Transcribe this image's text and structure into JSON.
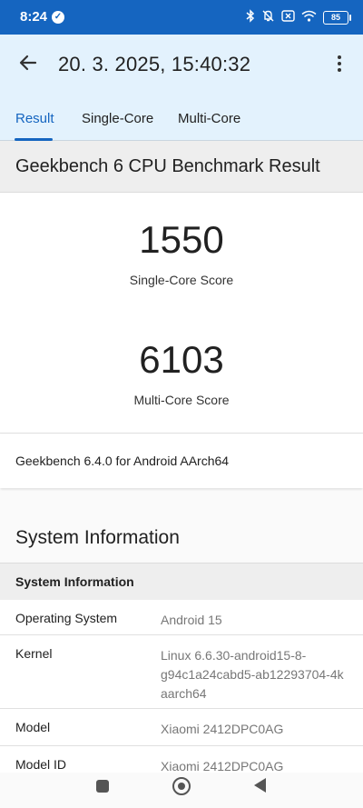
{
  "status_bar": {
    "time": "8:24",
    "battery": "85",
    "icons": [
      "check-circle-icon",
      "bluetooth-icon",
      "bell-off-icon",
      "sim-icon",
      "wifi-icon",
      "battery-icon"
    ]
  },
  "app_bar": {
    "title": "20. 3. 2025, 15:40:32",
    "back_icon": "arrow-left-icon",
    "menu_icon": "more-vertical-icon"
  },
  "tabs": [
    {
      "label": "Result",
      "active": true
    },
    {
      "label": "Single-Core",
      "active": false
    },
    {
      "label": "Multi-Core",
      "active": false
    }
  ],
  "result": {
    "heading": "Geekbench 6 CPU Benchmark Result",
    "single_core_score": "1550",
    "single_core_label": "Single-Core Score",
    "multi_core_score": "6103",
    "multi_core_label": "Multi-Core Score",
    "version": "Geekbench 6.4.0 for Android AArch64"
  },
  "system_info": {
    "title": "System Information",
    "subheading": "System Information",
    "rows": [
      {
        "key": "Operating System",
        "value": "Android 15"
      },
      {
        "key": "Kernel",
        "value": "Linux 6.6.30-android15-8-g94c1a24cabd5-ab12293704-4k aarch64"
      },
      {
        "key": "Model",
        "value": "Xiaomi 2412DPC0AG"
      },
      {
        "key": "Model ID",
        "value": "Xiaomi 2412DPC0AG"
      }
    ]
  },
  "colors": {
    "primary": "#1565c0",
    "app_bar_bg": "#e3f2fd"
  }
}
